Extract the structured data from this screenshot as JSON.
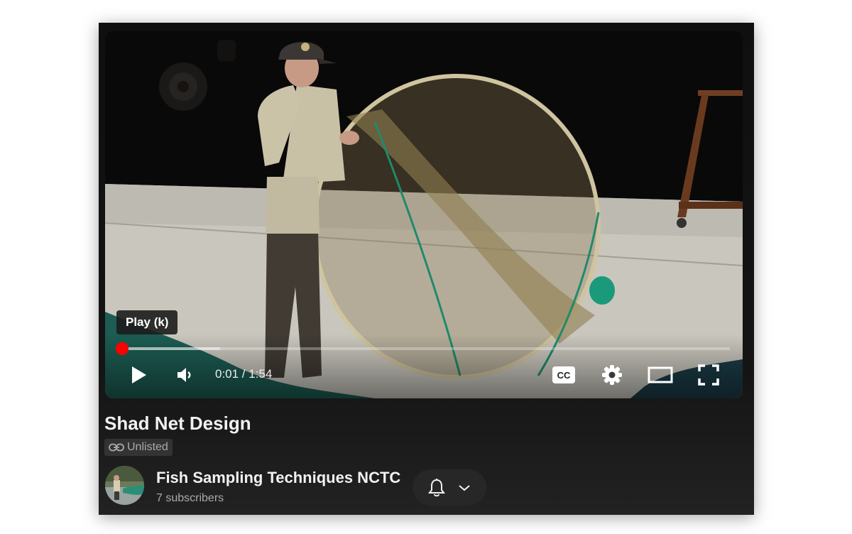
{
  "player": {
    "tooltip": "Play (k)",
    "time_display": "0:01 / 1:54",
    "played_fraction": 0.005,
    "loaded_fraction": 0.165,
    "accent_color": "#ff0000",
    "icons": {
      "play": "play-icon",
      "volume": "volume-icon",
      "captions": "closed-captions-icon",
      "settings": "gear-icon",
      "theater": "theater-mode-icon",
      "fullscreen": "fullscreen-icon"
    }
  },
  "video": {
    "title": "Shad Net Design",
    "visibility": "Unlisted"
  },
  "channel": {
    "name": "Fish Sampling Techniques NCTC",
    "subscribers": "7 subscribers",
    "notification_icon": "bell-icon",
    "dropdown_icon": "chevron-down-icon"
  }
}
